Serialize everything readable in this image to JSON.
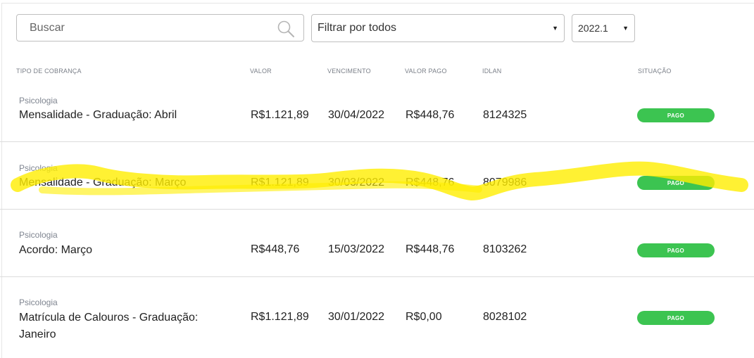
{
  "search": {
    "placeholder": "Buscar"
  },
  "filter": {
    "selected": "Filtrar por todos"
  },
  "period": {
    "selected": "2022.1"
  },
  "columns": {
    "tipo": "TIPO DE COBRANÇA",
    "valor": "VALOR",
    "vencimento": "VENCIMENTO",
    "valor_pago": "VALOR PAGO",
    "idlan": "IDLAN",
    "situacao": "SITUAÇÃO"
  },
  "rows": [
    {
      "curso": "Psicologia",
      "tipo": "Mensalidade - Graduação: Abril",
      "valor": "R$1.121,89",
      "vencimento": "30/04/2022",
      "valor_pago": "R$448,76",
      "idlan": "8124325",
      "situacao": "PAGO"
    },
    {
      "curso": "Psicologia",
      "tipo": "Mensalidade - Graduação: Março",
      "valor": "R$1.121,89",
      "vencimento": "30/03/2022",
      "valor_pago": "R$448,76",
      "idlan": "8079986",
      "situacao": "PAGO"
    },
    {
      "curso": "Psicologia",
      "tipo": "Acordo: Março",
      "valor": "R$448,76",
      "vencimento": "15/03/2022",
      "valor_pago": "R$448,76",
      "idlan": "8103262",
      "situacao": "PAGO"
    },
    {
      "curso": "Psicologia",
      "tipo": "Matrícula de Calouros - Graduação: Janeiro",
      "valor": "R$1.121,89",
      "vencimento": "30/01/2022",
      "valor_pago": "R$0,00",
      "idlan": "8028102",
      "situacao": "PAGO"
    }
  ],
  "colors": {
    "status_paid": "#3cc451",
    "highlighter": "#ffee00"
  }
}
